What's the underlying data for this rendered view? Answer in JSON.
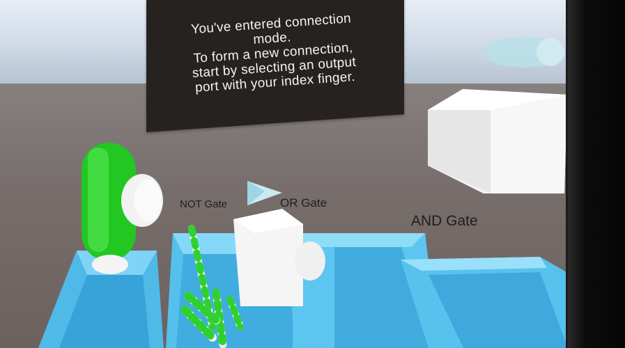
{
  "panel": {
    "line1": "You've entered connection",
    "line2": "mode.",
    "line3": "To form a new connection,",
    "line4": "start by selecting an output",
    "line5": "port with your index finger."
  },
  "gates": {
    "not": "NOT Gate",
    "or": "OR Gate",
    "and": "AND Gate"
  },
  "colors": {
    "panel_bg": "#26221f",
    "trough": "#5ec8f2",
    "pill": "#2fd12f",
    "cube": "#f4f4f4"
  }
}
